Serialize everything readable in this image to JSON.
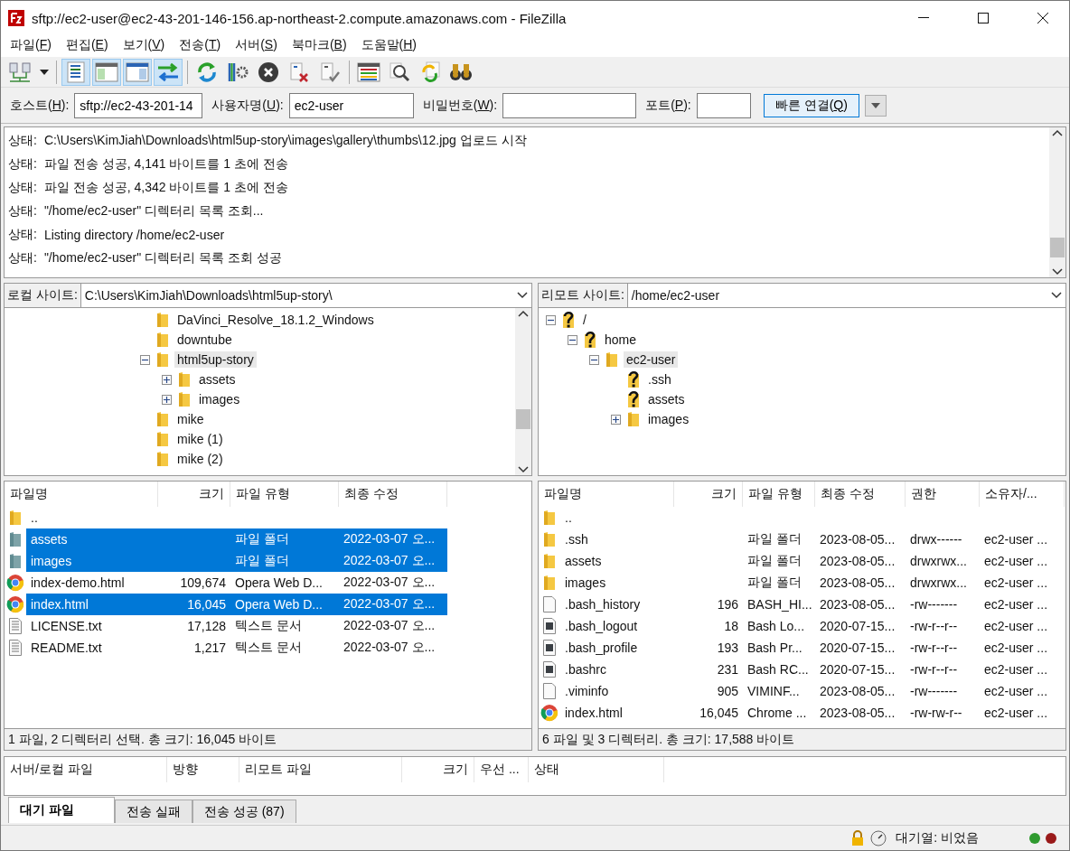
{
  "window": {
    "title": "sftp://ec2-user@ec2-43-201-146-156.ap-northeast-2.compute.amazonaws.com - FileZilla"
  },
  "menu": [
    "파일(F)",
    "편집(E)",
    "보기(V)",
    "전송(T)",
    "서버(S)",
    "북마크(B)",
    "도움말(H)"
  ],
  "toolbar": [
    {
      "kind": "site-manager"
    },
    {
      "kind": "dropdown"
    },
    {
      "kind": "sep"
    },
    {
      "kind": "message-log",
      "on": true
    },
    {
      "kind": "local-tree",
      "on": true
    },
    {
      "kind": "remote-tree",
      "on": true
    },
    {
      "kind": "queue",
      "on": true
    },
    {
      "kind": "sep"
    },
    {
      "kind": "refresh"
    },
    {
      "kind": "filter-process"
    },
    {
      "kind": "cancel"
    },
    {
      "kind": "disconnect"
    },
    {
      "kind": "reconnect"
    },
    {
      "kind": "sep"
    },
    {
      "kind": "dir-listing"
    },
    {
      "kind": "search"
    },
    {
      "kind": "compare"
    },
    {
      "kind": "find"
    }
  ],
  "quickconnect": {
    "fields": [
      {
        "label": "호스트(H):",
        "value": "sftp://ec2-43-201-14"
      },
      {
        "label": "사용자명(U):",
        "value": "ec2-user"
      },
      {
        "label": "비밀번호(W):"
      },
      {
        "label": "포트(P):"
      }
    ],
    "button": "빠른 연결(Q)"
  },
  "log": [
    {
      "label": "상태:",
      "text": "C:\\Users\\KimJiah\\Downloads\\html5up-story\\images\\gallery\\thumbs\\12.jpg 업로드 시작"
    },
    {
      "label": "상태:",
      "text": "파일 전송 성공, 4,141 바이트를 1 초에 전송"
    },
    {
      "label": "상태:",
      "text": "파일 전송 성공, 4,342 바이트를 1 초에 전송"
    },
    {
      "label": "상태:",
      "text": "\"/home/ec2-user\" 디렉터리 목록 조회..."
    },
    {
      "label": "상태:",
      "text": "Listing directory /home/ec2-user"
    },
    {
      "label": "상태:",
      "text": "\"/home/ec2-user\" 디렉터리 목록 조회 성공"
    }
  ],
  "local": {
    "site_label": "로컬 사이트:",
    "path": "C:\\Users\\KimJiah\\Downloads\\html5up-story\\",
    "tree": [
      {
        "name": "DaVinci_Resolve_18.1.2_Windows",
        "kind": "folder",
        "selected": false
      },
      {
        "name": "downtube",
        "kind": "folder",
        "selected": false
      },
      {
        "name": "html5up-story",
        "kind": "folder",
        "selected": true,
        "expanded": true,
        "children": [
          {
            "name": "assets",
            "kind": "folder",
            "selected": false,
            "expanded": false
          },
          {
            "name": "images",
            "kind": "folder",
            "selected": false,
            "expanded": false
          }
        ]
      },
      {
        "name": "mike",
        "kind": "folder",
        "selected": false
      },
      {
        "name": "mike (1)",
        "kind": "folder",
        "selected": false
      },
      {
        "name": "mike (2)",
        "kind": "folder",
        "selected": false
      }
    ],
    "columns": [
      "파일명",
      "크기",
      "파일 유형",
      "최종 수정"
    ],
    "rows": [
      {
        "kind": "folder",
        "cells": [
          ".."
        ],
        "selected": false
      },
      {
        "kind": "folder",
        "cells": [
          "assets",
          "",
          "파일 폴더",
          "2022-03-07 오..."
        ],
        "selected": true
      },
      {
        "kind": "folder",
        "cells": [
          "images",
          "",
          "파일 폴더",
          "2022-03-07 오..."
        ],
        "selected": true
      },
      {
        "kind": "browser",
        "cells": [
          "index-demo.html",
          "109,674",
          "Opera Web D...",
          "2022-03-07 오..."
        ],
        "selected": false
      },
      {
        "kind": "browser",
        "cells": [
          "index.html",
          "16,045",
          "Opera Web D...",
          "2022-03-07 오..."
        ],
        "selected": true
      },
      {
        "kind": "text",
        "cells": [
          "LICENSE.txt",
          "17,128",
          "텍스트 문서",
          "2022-03-07 오..."
        ],
        "selected": false
      },
      {
        "kind": "text",
        "cells": [
          "README.txt",
          "1,217",
          "텍스트 문서",
          "2022-03-07 오..."
        ],
        "selected": false
      }
    ],
    "status": "1 파일, 2 디렉터리 선택. 총 크기: 16,045 바이트"
  },
  "remote": {
    "site_label": "리모트 사이트:",
    "path": "/home/ec2-user",
    "tree": [
      {
        "name": "/",
        "kind": "unknown",
        "selected": false,
        "expanded": true,
        "children": [
          {
            "name": "home",
            "kind": "unknown",
            "selected": false,
            "expanded": true,
            "children": [
              {
                "name": "ec2-user",
                "kind": "folder",
                "selected": true,
                "expanded": true,
                "children": [
                  {
                    "name": ".ssh",
                    "kind": "unknown",
                    "selected": false
                  },
                  {
                    "name": "assets",
                    "kind": "unknown",
                    "selected": false
                  },
                  {
                    "name": "images",
                    "kind": "folder",
                    "selected": false,
                    "expanded": false
                  }
                ]
              }
            ]
          }
        ]
      }
    ],
    "columns": [
      "파일명",
      "크기",
      "파일 유형",
      "최종 수정",
      "권한",
      "소유자/..."
    ],
    "rows": [
      {
        "kind": "folder",
        "cells": [
          ".."
        ],
        "selected": false
      },
      {
        "kind": "folder",
        "cells": [
          ".ssh",
          "",
          "파일 폴더",
          "2023-08-05...",
          "drwx------",
          "ec2-user ..."
        ],
        "selected": false
      },
      {
        "kind": "folder",
        "cells": [
          "assets",
          "",
          "파일 폴더",
          "2023-08-05...",
          "drwxrwx...",
          "ec2-user ..."
        ],
        "selected": false
      },
      {
        "kind": "folder",
        "cells": [
          "images",
          "",
          "파일 폴더",
          "2023-08-05...",
          "drwxrwx...",
          "ec2-user ..."
        ],
        "selected": false
      },
      {
        "kind": "blank",
        "cells": [
          ".bash_history",
          "196",
          "BASH_HI...",
          "2023-08-05...",
          "-rw-------",
          "ec2-user ..."
        ],
        "selected": false
      },
      {
        "kind": "script",
        "cells": [
          ".bash_logout",
          "18",
          "Bash Lo...",
          "2020-07-15...",
          "-rw-r--r--",
          "ec2-user ..."
        ],
        "selected": false
      },
      {
        "kind": "script",
        "cells": [
          ".bash_profile",
          "193",
          "Bash Pr...",
          "2020-07-15...",
          "-rw-r--r--",
          "ec2-user ..."
        ],
        "selected": false
      },
      {
        "kind": "script",
        "cells": [
          ".bashrc",
          "231",
          "Bash RC...",
          "2020-07-15...",
          "-rw-r--r--",
          "ec2-user ..."
        ],
        "selected": false
      },
      {
        "kind": "blank",
        "cells": [
          ".viminfo",
          "905",
          "VIMINF...",
          "2023-08-05...",
          "-rw-------",
          "ec2-user ..."
        ],
        "selected": false
      },
      {
        "kind": "browser",
        "cells": [
          "index.html",
          "16,045",
          "Chrome ...",
          "2023-08-05...",
          "-rw-rw-r--",
          "ec2-user ..."
        ],
        "selected": false
      }
    ],
    "status": "6 파일 및 3 디렉터리. 총 크기: 17,588 바이트"
  },
  "queue": {
    "columns": [
      "서버/로컬 파일",
      "방향",
      "리모트 파일",
      "크기",
      "우선 ...",
      "상태"
    ],
    "tabs": [
      {
        "label": "대기 파일",
        "selected": true
      },
      {
        "label": "전송 실패",
        "selected": false
      },
      {
        "label": "전송 성공 (87)",
        "selected": false
      }
    ]
  },
  "status_bar": {
    "queue": "대기열: 비었음",
    "lights": [
      {
        "color": "#2f9a2f"
      },
      {
        "color": "#9a1a1a"
      }
    ]
  }
}
